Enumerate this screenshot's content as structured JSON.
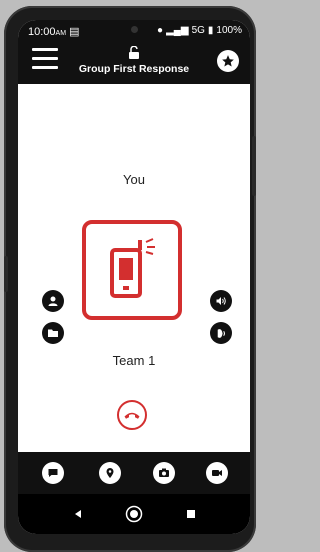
{
  "status": {
    "time": "10:00",
    "ampm": "AM",
    "battery": "100%",
    "network": "5G"
  },
  "header": {
    "title": "Group First Response"
  },
  "call": {
    "caller_label": "You",
    "callee_label": "Team 1"
  },
  "colors": {
    "accent": "#d32f2f",
    "header_bg": "#111111"
  },
  "icons": {
    "menu": "hamburger-icon",
    "lock": "unlock-icon",
    "favorite": "star-icon",
    "contact": "person-icon",
    "folder": "folder-icon",
    "volume": "speaker-icon",
    "earpiece": "earpiece-icon",
    "hangup": "phone-hangup-icon",
    "tabs": [
      "chat-icon",
      "location-icon",
      "camera-icon",
      "video-icon"
    ],
    "nav": [
      "back-icon",
      "home-icon",
      "recents-icon"
    ]
  }
}
